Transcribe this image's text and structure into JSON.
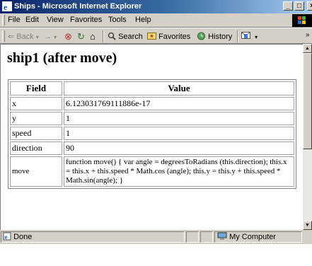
{
  "window": {
    "title": "Ships - Microsoft Internet Explorer"
  },
  "title_buttons": {
    "minimize": "_",
    "maximize": "□",
    "close": "×"
  },
  "menu": [
    "File",
    "Edit",
    "View",
    "Favorites",
    "Tools",
    "Help"
  ],
  "toolbar": {
    "back": "⇐ Back",
    "forward": "→",
    "stop": "⊗",
    "refresh": "↻",
    "home": "⌂",
    "search": "Search",
    "favorites": "Favorites",
    "history": "History",
    "more": "»"
  },
  "page": {
    "heading": "ship1 (after move)",
    "table_headers": [
      "Field",
      "Value"
    ],
    "rows": [
      {
        "field": "x",
        "value": "6.123031769111886e-17"
      },
      {
        "field": "y",
        "value": "1"
      },
      {
        "field": "speed",
        "value": "1"
      },
      {
        "field": "direction",
        "value": "90"
      },
      {
        "field": "move",
        "value": "function move() { var angle = degreesToRadians (this.direction); this.x = this.x + this.speed * Math.cos (angle); this.y = this.y + this.speed * Math.sin(angle); }"
      }
    ]
  },
  "status": {
    "left": "Done",
    "zone": "My Computer"
  },
  "icons": [
    "ie-icon",
    "back-icon",
    "forward-icon",
    "stop-icon",
    "refresh-icon",
    "home-icon",
    "search-icon",
    "favorites-icon",
    "history-icon",
    "mail-icon",
    "page-done-icon",
    "my-computer-icon"
  ]
}
